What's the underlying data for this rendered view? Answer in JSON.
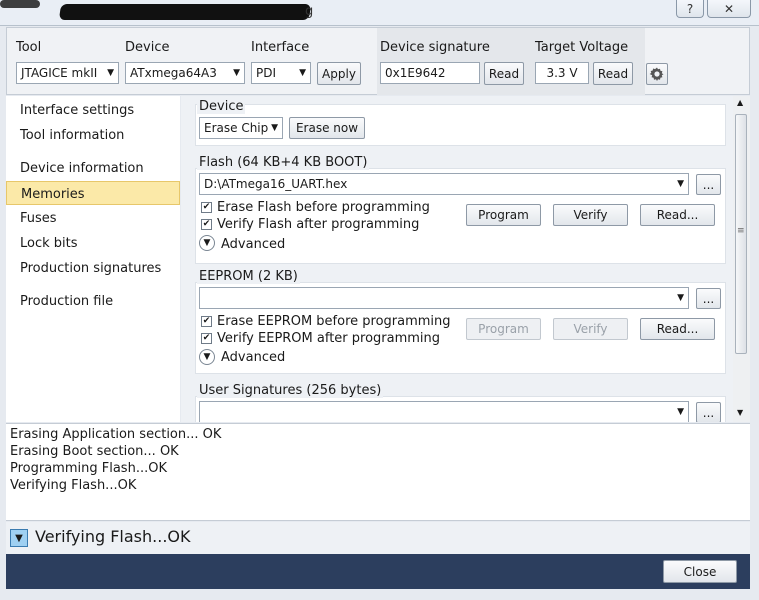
{
  "window": {
    "title_visible": "g",
    "help_label": "?",
    "close_label": "✕"
  },
  "toolbar": {
    "tool_label": "Tool",
    "tool_value": "JTAGICE mkII",
    "device_label": "Device",
    "device_value": "ATxmega64A3",
    "interface_label": "Interface",
    "interface_value": "PDI",
    "apply_label": "Apply",
    "signature_label": "Device signature",
    "signature_value": "0x1E9642",
    "signature_read_label": "Read",
    "voltage_label": "Target Voltage",
    "voltage_value": "3.3 V",
    "voltage_read_label": "Read"
  },
  "sidebar": {
    "items": [
      {
        "label": "Interface settings"
      },
      {
        "label": "Tool information"
      },
      {
        "label": "Device information"
      },
      {
        "label": "Memories",
        "selected": true
      },
      {
        "label": "Fuses"
      },
      {
        "label": "Lock bits"
      },
      {
        "label": "Production signatures"
      },
      {
        "label": "Production file"
      }
    ]
  },
  "device_group": {
    "title": "Device",
    "erase_select": "Erase Chip",
    "erase_now_label": "Erase now"
  },
  "flash_group": {
    "title": "Flash (64 KB+4 KB BOOT)",
    "file_value": "D:\\ATmega16_UART.hex",
    "browse_label": "...",
    "erase_before_label": "Erase Flash before programming",
    "erase_before_checked": true,
    "verify_after_label": "Verify Flash after programming",
    "verify_after_checked": true,
    "advanced_label": "Advanced",
    "program_label": "Program",
    "verify_label": "Verify",
    "read_label": "Read..."
  },
  "eeprom_group": {
    "title": "EEPROM (2 KB)",
    "file_value": "",
    "browse_label": "...",
    "erase_before_label": "Erase EEPROM before programming",
    "erase_before_checked": true,
    "verify_after_label": "Verify EEPROM after programming",
    "verify_after_checked": true,
    "advanced_label": "Advanced",
    "program_label": "Program",
    "verify_label": "Verify",
    "read_label": "Read..."
  },
  "usersig_group": {
    "title": "User Signatures (256 bytes)",
    "file_value": "",
    "browse_label": "..."
  },
  "log": {
    "lines": [
      "Erasing Application section... OK",
      "Erasing Boot section... OK",
      "Programming Flash...OK",
      "Verifying Flash...OK"
    ]
  },
  "status": {
    "text": "Verifying Flash...OK"
  },
  "footer": {
    "close_label": "Close"
  },
  "icons": {
    "gear": "gear-icon",
    "dropdown": "chevron-down-icon",
    "advanced": "expand-icon"
  },
  "colors": {
    "selected_bg": "#fbe9a8",
    "footer_bg": "#2c3e5e"
  }
}
